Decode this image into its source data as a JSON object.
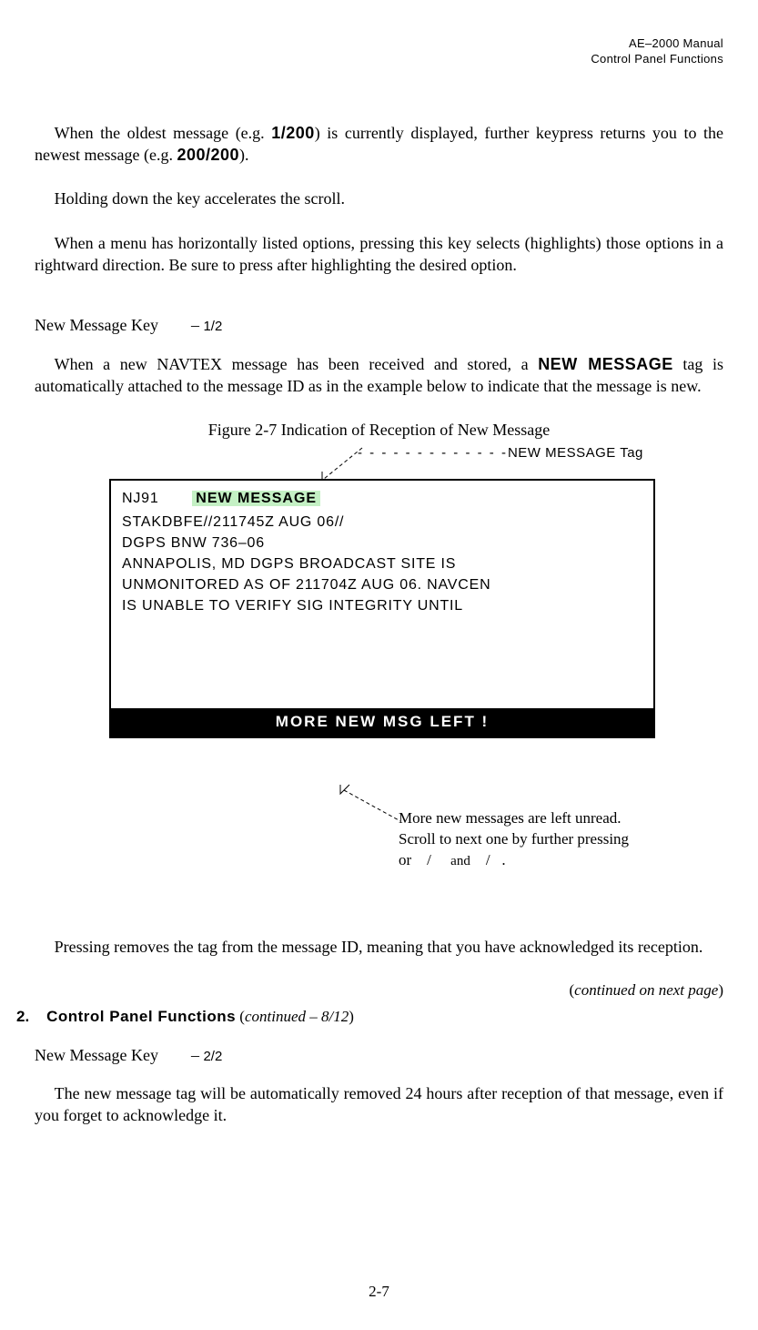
{
  "header": {
    "line1": "AE–2000 Manual",
    "line2": "Control Panel Functions"
  },
  "p1_a": "When the oldest message (e.g. ",
  "p1_b": "1/200",
  "p1_c": ") is currently displayed, further keypress returns you to the newest message (e.g. ",
  "p1_d": "200/200",
  "p1_e": ").",
  "p2": "Holding down the key accelerates the scroll.",
  "p3": "When a menu has horizontally listed options, pressing this key selects (highlights) those options in a rightward direction. Be sure to press      after highlighting the desired option.",
  "section1": {
    "label": "New Message Key",
    "dash": "–",
    "frac": "1/2"
  },
  "p4_a": "When a new NAVTEX message has been received and stored, a ",
  "p4_b": "NEW MESSAGE",
  "p4_c": " tag is automatically attached to the message ID as in the example below to indicate that the message is new.",
  "figcap": "Figure 2-7   Indication of Reception of New Message",
  "tagcallout_dashes": "- - - - - - - - - - - - -",
  "tagcallout_text": "NEW MESSAGE Tag",
  "display": {
    "id": "NJ91",
    "tag": "NEW MESSAGE",
    "l1": "STAKDBFE//211745Z AUG 06//",
    "l2": "DGPS BNW 736–06",
    "l3": "ANNAPOLIS, MD DGPS BROADCAST SITE IS",
    "l4": "UNMONITORED AS OF 211704Z AUG 06. NAVCEN",
    "l5": "IS UNABLE TO VERIFY SIG INTEGRITY UNTIL",
    "morebar": "MORE NEW MSG LEFT !"
  },
  "morecallout_l1": "More new messages are left unread.",
  "morecallout_l2": "Scroll to next one by further pressing",
  "morecallout_l3a": "or",
  "morecallout_l3b": "/",
  "morecallout_l3c": "and",
  "morecallout_l3d": "/",
  "morecallout_l3e": ".",
  "p5": "Pressing       removes the tag from the message ID, meaning that you have acknowledged its reception.",
  "contright_a": "(",
  "contright_b": "continued on next page",
  "contright_c": ")",
  "sectitle": {
    "num": "2.",
    "name": "Control Panel Functions",
    "cont_a": " (",
    "cont_b": "continued – 8/12",
    "cont_c": ")"
  },
  "section2": {
    "label": "New Message Key",
    "dash": "–",
    "frac": "2/2"
  },
  "p6": "The new message tag will be automatically removed 24 hours after reception of that message, even if you forget to acknowledge it.",
  "pagenum": "2-7"
}
